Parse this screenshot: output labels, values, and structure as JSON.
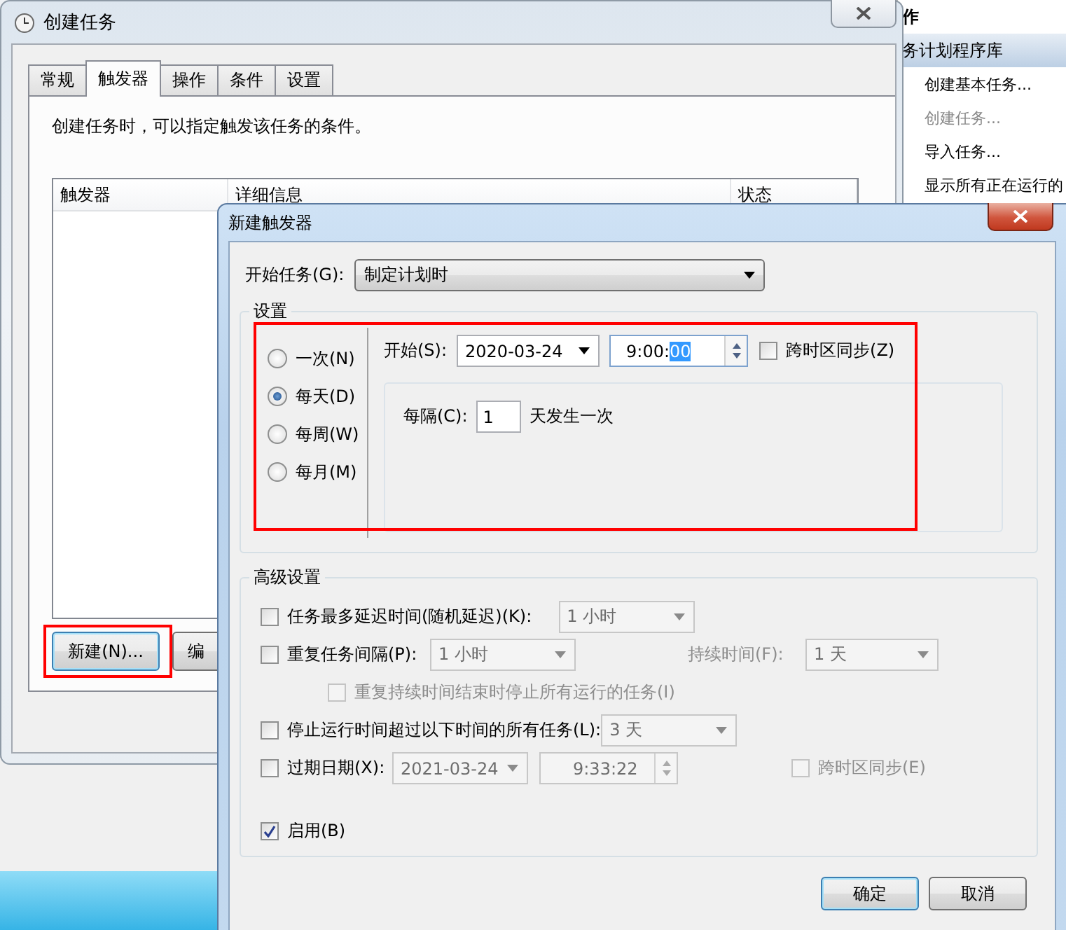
{
  "task_window": {
    "title": "创建任务",
    "tabs": [
      {
        "label": "常规",
        "selected": false
      },
      {
        "label": "触发器",
        "selected": true
      },
      {
        "label": "操作",
        "selected": false
      },
      {
        "label": "条件",
        "selected": false
      },
      {
        "label": "设置",
        "selected": false
      }
    ],
    "description": "创建任务时，可以指定触发该任务的条件。",
    "trigger_list": {
      "columns": [
        "触发器",
        "详细信息",
        "状态"
      ]
    },
    "buttons": [
      {
        "label": "新建(N)...",
        "highlighted": true
      },
      {
        "label": "编",
        "highlighted": false
      }
    ]
  },
  "actions_pane": {
    "heading": "作",
    "section": "务计划程序库",
    "items": [
      {
        "label": "创建基本任务...",
        "disabled": false
      },
      {
        "label": "创建任务...",
        "disabled": true
      },
      {
        "label": "导入任务...",
        "disabled": false
      },
      {
        "label": "显示所有正在运行的",
        "disabled": false
      }
    ]
  },
  "trigger_dialog": {
    "title": "新建触发器",
    "begin_task": {
      "label": "开始任务(G):",
      "value": "制定计划时"
    },
    "settings": {
      "title": "设置",
      "highlighted": true,
      "schedules": [
        {
          "label": "一次(N)",
          "selected": false
        },
        {
          "label": "每天(D)",
          "selected": true
        },
        {
          "label": "每周(W)",
          "selected": false
        },
        {
          "label": "每月(M)",
          "selected": false
        }
      ],
      "start": {
        "label": "开始(S):",
        "date": "2020-03-24",
        "time": "9:00:",
        "time_selected": "00",
        "sync": {
          "label": "跨时区同步(Z)",
          "checked": false
        }
      },
      "recur": {
        "label": "每隔(C):",
        "value": "1",
        "unit": "天发生一次"
      }
    },
    "advanced": {
      "title": "高级设置",
      "rows": [
        {
          "kind": "option",
          "checkbox": {
            "label": "任务最多延迟时间(随机延迟)(K):",
            "checked": false,
            "disabled": false
          },
          "controls": [
            {
              "kind": "dropdown",
              "value": "1 小时",
              "disabled": true
            }
          ]
        },
        {
          "kind": "option",
          "checkbox": {
            "label": "重复任务间隔(P):",
            "checked": false,
            "disabled": false
          },
          "controls": [
            {
              "kind": "dropdown",
              "value": "1 小时",
              "disabled": true
            },
            {
              "kind": "label",
              "text": "持续时间(F):",
              "disabled": true
            },
            {
              "kind": "dropdown",
              "value": "1 天",
              "disabled": true
            }
          ]
        },
        {
          "kind": "sub_option",
          "checkbox": {
            "label": "重复持续时间结束时停止所有运行的任务(I)",
            "checked": false,
            "disabled": true
          }
        },
        {
          "kind": "option",
          "checkbox": {
            "label": "停止运行时间超过以下时间的所有任务(L):",
            "checked": false,
            "disabled": false
          },
          "controls": [
            {
              "kind": "dropdown",
              "value": "3 天",
              "disabled": true
            }
          ]
        },
        {
          "kind": "option",
          "checkbox": {
            "label": "过期日期(X):",
            "checked": false,
            "disabled": false
          },
          "controls": [
            {
              "kind": "date",
              "value": "2021-03-24",
              "disabled": true
            },
            {
              "kind": "time",
              "value": "9:33:22",
              "disabled": true
            },
            {
              "kind": "checkbox",
              "label": "跨时区同步(E)",
              "checked": false,
              "disabled": true
            }
          ]
        },
        {
          "kind": "standalone",
          "checkbox": {
            "label": "启用(B)",
            "checked": true,
            "disabled": false
          }
        }
      ]
    },
    "buttons": [
      {
        "label": "确定",
        "default": true
      },
      {
        "label": "取消",
        "default": false
      }
    ]
  }
}
